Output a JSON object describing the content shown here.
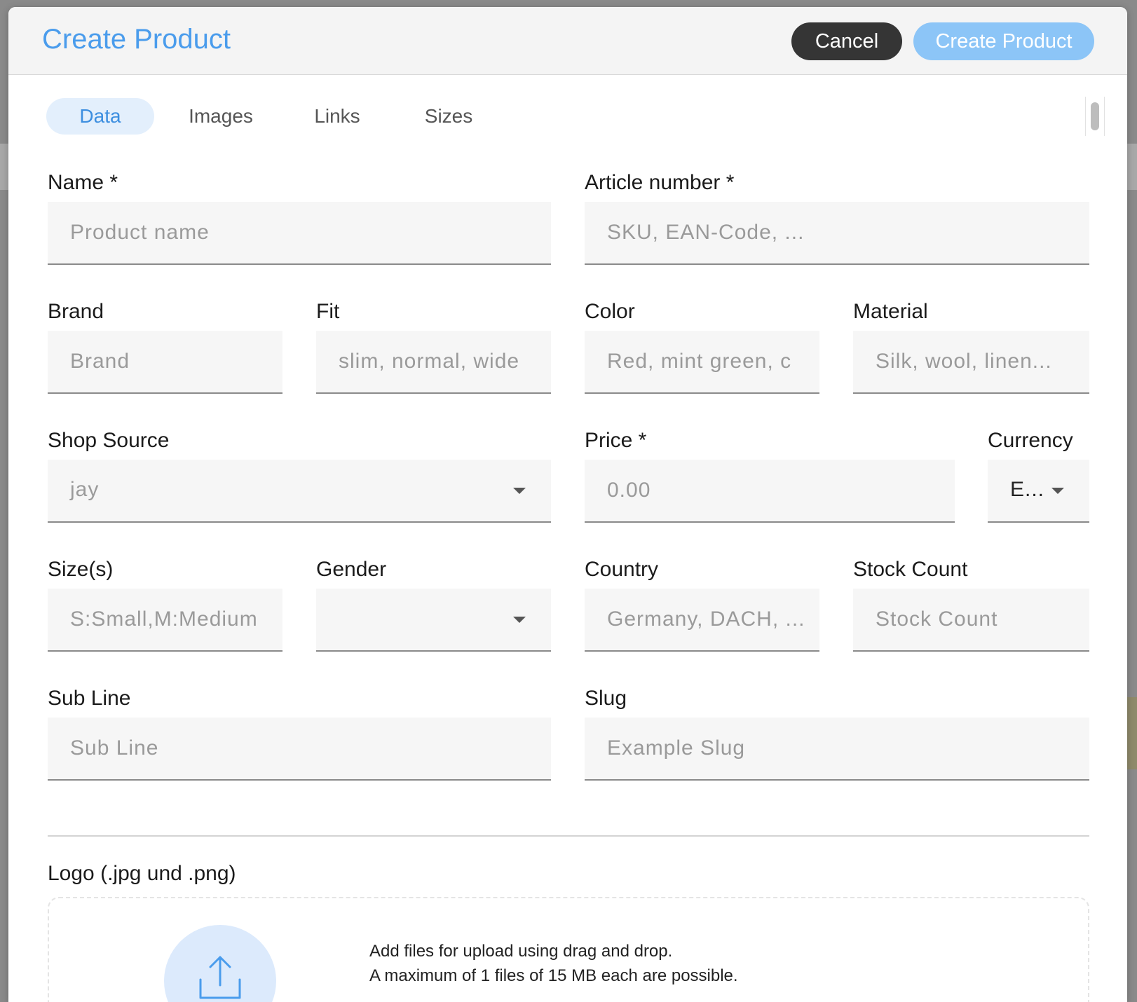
{
  "header": {
    "title": "Create Product",
    "cancel_label": "Cancel",
    "create_label": "Create Product"
  },
  "tabs": [
    {
      "label": "Data",
      "active": true
    },
    {
      "label": "Images",
      "active": false
    },
    {
      "label": "Links",
      "active": false
    },
    {
      "label": "Sizes",
      "active": false
    }
  ],
  "form": {
    "name": {
      "label": "Name *",
      "placeholder": "Product name",
      "value": ""
    },
    "article_number": {
      "label": "Article number *",
      "placeholder": "SKU, EAN-Code, ...",
      "value": ""
    },
    "brand": {
      "label": "Brand",
      "placeholder": "Brand",
      "value": ""
    },
    "fit": {
      "label": "Fit",
      "placeholder": "slim, normal, wide",
      "value": ""
    },
    "color": {
      "label": "Color",
      "placeholder": "Red, mint green, c",
      "value": ""
    },
    "material": {
      "label": "Material",
      "placeholder": "Silk, wool, linen...",
      "value": ""
    },
    "shop_source": {
      "label": "Shop Source",
      "selected": "jay"
    },
    "price": {
      "label": "Price *",
      "placeholder": "0.00",
      "value": ""
    },
    "currency": {
      "label": "Currency",
      "selected": "E..."
    },
    "sizes": {
      "label": "Size(s)",
      "placeholder": "S:Small,M:Medium",
      "value": ""
    },
    "gender": {
      "label": "Gender",
      "selected": ""
    },
    "country": {
      "label": "Country",
      "placeholder": "Germany, DACH, ...",
      "value": ""
    },
    "stock_count": {
      "label": "Stock Count",
      "placeholder": "Stock Count",
      "value": ""
    },
    "sub_line": {
      "label": "Sub Line",
      "placeholder": "Sub Line",
      "value": ""
    },
    "slug": {
      "label": "Slug",
      "placeholder": "Example Slug",
      "value": ""
    }
  },
  "logo": {
    "label": "Logo (.jpg und .png)",
    "upload_line1": "Add files for upload using drag and drop.",
    "upload_line2": "A maximum of 1 files of 15 MB each are possible.",
    "icon": "upload-arrow-icon"
  },
  "colors": {
    "accent": "#4a9cec",
    "create_button": "#8cc5f7",
    "cancel_button": "#353535",
    "field_background": "#f6f6f6"
  }
}
